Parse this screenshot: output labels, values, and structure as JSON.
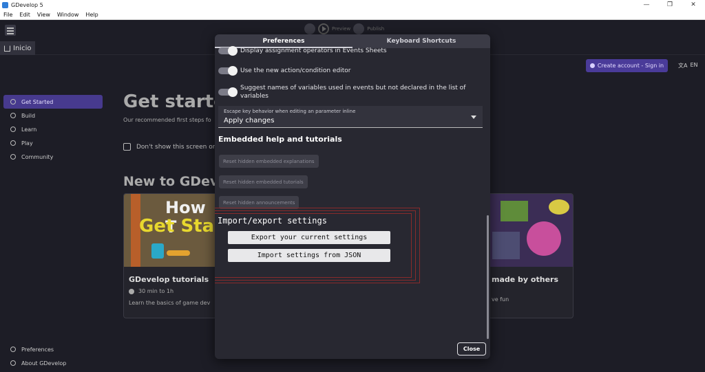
{
  "window": {
    "title": "GDevelop 5",
    "controls": [
      "—",
      "❐",
      "✕"
    ]
  },
  "menu": [
    "File",
    "Edit",
    "View",
    "Window",
    "Help"
  ],
  "toolbar": {
    "preview": "Preview",
    "publish": "Publish"
  },
  "home_tab": "Inicio",
  "header": {
    "create_account": "Create account - Sign in",
    "lang": "EN",
    "lang_icon": "文A"
  },
  "sidebar": {
    "items": [
      {
        "label": "Get Started",
        "icon": "sparkle-icon",
        "active": true
      },
      {
        "label": "Build",
        "icon": "hammer-icon"
      },
      {
        "label": "Learn",
        "icon": "graduation-icon"
      },
      {
        "label": "Play",
        "icon": "gamepad-icon"
      },
      {
        "label": "Community",
        "icon": "globe-icon"
      }
    ],
    "bottom": [
      {
        "label": "Preferences",
        "icon": "gear-icon"
      },
      {
        "label": "About GDevelop",
        "icon": "gdevelop-icon"
      }
    ]
  },
  "main": {
    "title": "Get starte",
    "subtitle": "Our recommended first steps fo",
    "dont_show": "Don't show this screen on",
    "section": "New to GDevel",
    "cards": [
      {
        "thumb_top": "How T",
        "thumb_bottom": "Get Sta",
        "title": "GDevelop tutorials",
        "meta": "30 min to 1h",
        "desc": "Learn the basics of game dev"
      },
      {
        "title": "made by others",
        "desc": "ve fun"
      }
    ]
  },
  "modal": {
    "tabs": [
      "Preferences",
      "Keyboard Shortcuts"
    ],
    "toggles": [
      "Display assignment operators in Events Sheets",
      "Use the new action/condition editor",
      "Suggest names of variables used in events but not declared in the list of variables"
    ],
    "select": {
      "label": "Escape key behavior when editing an parameter inline",
      "value": "Apply changes"
    },
    "embedded_title": "Embedded help and tutorials",
    "reset_buttons": [
      "Reset hidden embedded explanations",
      "Reset hidden embedded tutorials",
      "Reset hidden announcements"
    ],
    "import_title": "Import/export settings",
    "export_button": "Export your current settings",
    "import_button": "Import settings from JSON",
    "close": "Close"
  }
}
